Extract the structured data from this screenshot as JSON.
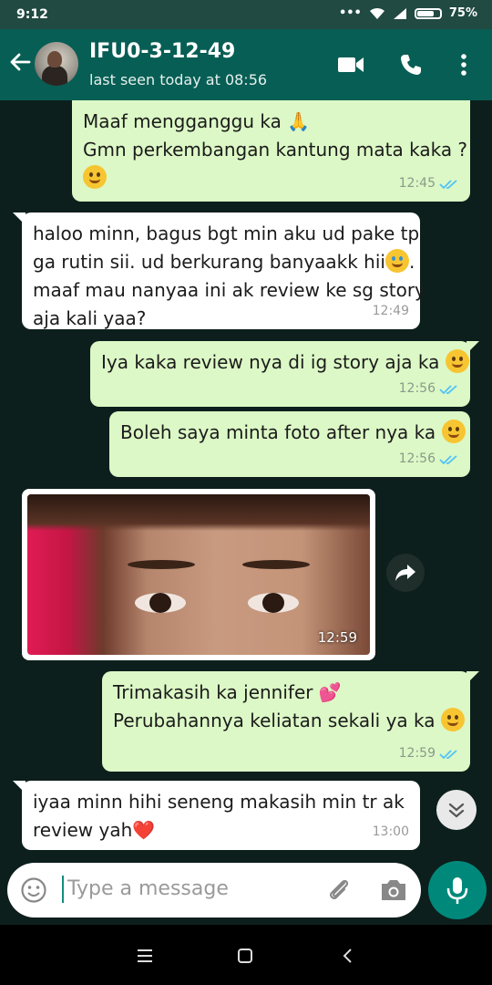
{
  "status_bar": {
    "time": "9:12",
    "battery": "75%",
    "battery_level": 0.75
  },
  "header": {
    "contact_name": "IFU0-3-12-49",
    "last_seen": "last seen today at 08:56"
  },
  "messages": [
    {
      "direction": "out",
      "lines": [
        "Maaf mengganggu ka 🙏",
        "Gmn perkembangan kantung mata kaka ?"
      ],
      "emoji_line": "hug",
      "time": "12:45",
      "status": "read"
    },
    {
      "direction": "in",
      "lines": [
        "haloo minn, bagus bgt min aku ud pake tp",
        "ga rutin sii. ud berkurang banyaakk hii",
        "maaf mau nanyaa ini ak review ke sg story",
        "aja kali yaa?"
      ],
      "time": "12:49"
    },
    {
      "direction": "out",
      "lines": [
        "Iya kaka review nya di ig story aja ka"
      ],
      "time": "12:56",
      "status": "read"
    },
    {
      "direction": "out",
      "lines": [
        "Boleh saya minta foto after nya ka"
      ],
      "time": "12:56",
      "status": "read"
    },
    {
      "direction": "in",
      "type": "image",
      "time": "12:59"
    },
    {
      "direction": "out",
      "lines": [
        "Trimakasih ka jennifer",
        "Perubahannya keliatan sekali ya ka"
      ],
      "time": "12:59",
      "status": "read"
    },
    {
      "direction": "in",
      "lines": [
        "iyaa minn hihi seneng makasih min tr ak",
        "review yah❤️"
      ],
      "time": "13:00"
    }
  ],
  "composer": {
    "placeholder": "Type a message"
  },
  "colors": {
    "app_bar": "#075e54",
    "outgoing": "#dcf8c6",
    "incoming": "#ffffff",
    "accent": "#00897b",
    "read_ticks": "#4fc3f7"
  },
  "icons": [
    "back-arrow-icon",
    "video-call-icon",
    "phone-icon",
    "more-options-icon",
    "forward-icon",
    "scroll-down-icon",
    "emoji-icon",
    "attach-icon",
    "camera-icon",
    "mic-icon"
  ]
}
